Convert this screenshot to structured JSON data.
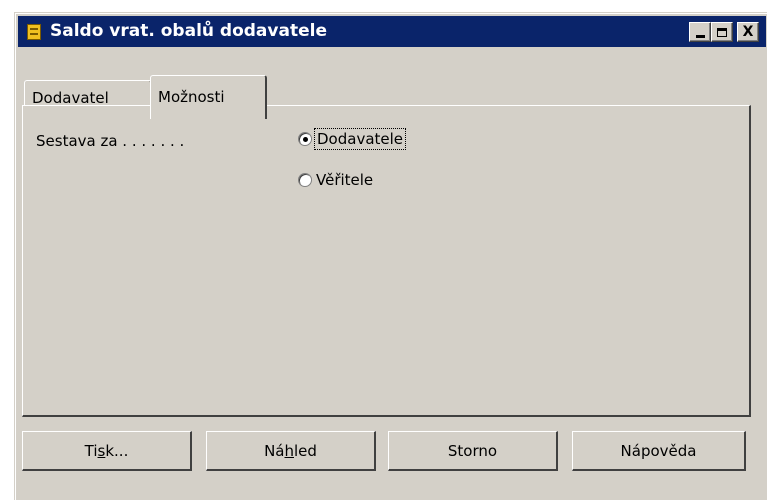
{
  "window": {
    "title": "Saldo vrat. obalů dodavatele",
    "controls": {
      "minimize": "_",
      "maximize": "□",
      "close": "X"
    }
  },
  "tabs": [
    {
      "label": "Dodavatel",
      "active": false
    },
    {
      "label": "Možnosti",
      "active": true
    }
  ],
  "options": {
    "report_for_label": "Sestava za . . . . . . .",
    "radio_options": [
      {
        "label": "Dodavatele",
        "checked": true
      },
      {
        "label": "Věřitele",
        "checked": false
      }
    ]
  },
  "buttons": {
    "print": {
      "before": "Ti",
      "access": "s",
      "after": "k..."
    },
    "preview": {
      "before": "Ná",
      "access": "h",
      "after": "led"
    },
    "cancel": "Storno",
    "help": "Nápověda"
  }
}
